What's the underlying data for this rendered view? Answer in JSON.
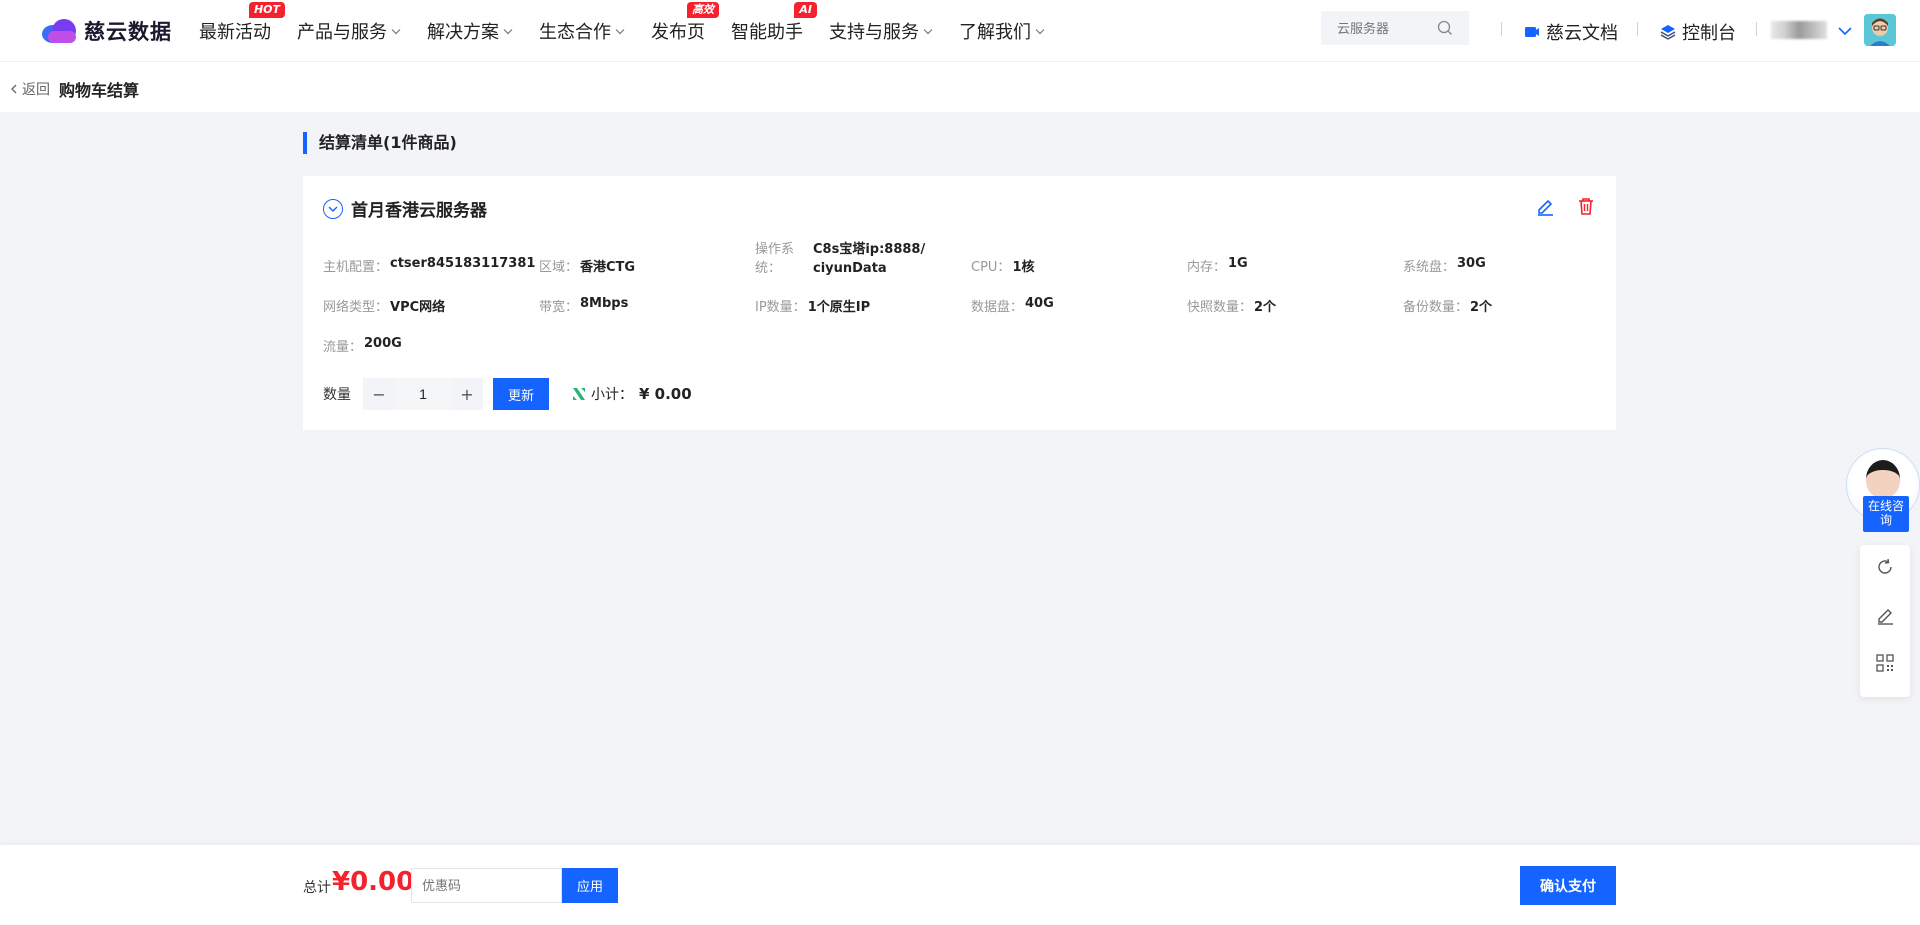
{
  "header": {
    "logo_text": "慈云数据",
    "nav": [
      {
        "label": "最新活动",
        "badge": "HOT",
        "has_dropdown": false
      },
      {
        "label": "产品与服务",
        "badge": "",
        "has_dropdown": true
      },
      {
        "label": "解决方案",
        "badge": "",
        "has_dropdown": true
      },
      {
        "label": "生态合作",
        "badge": "",
        "has_dropdown": true
      },
      {
        "label": "发布页",
        "badge": "高效",
        "has_dropdown": false
      },
      {
        "label": "智能助手",
        "badge": "AI",
        "has_dropdown": false
      },
      {
        "label": "支持与服务",
        "badge": "",
        "has_dropdown": true
      },
      {
        "label": "了解我们",
        "badge": "",
        "has_dropdown": true
      }
    ],
    "search_placeholder": "云服务器",
    "docs_label": "慈云文档",
    "console_label": "控制台"
  },
  "breadcrumb": {
    "back_label": "返回",
    "title": "购物车结算"
  },
  "section_title": "结算清单(1件商品)",
  "product": {
    "name": "首月香港云服务器",
    "specs": [
      {
        "label": "主机配置：",
        "value": "ctser845183117381"
      },
      {
        "label": "区域：",
        "value": "香港CTG"
      },
      {
        "label": "操作系统：",
        "value": "C8s宝塔ip:8888/ciyunData"
      },
      {
        "label": "CPU：",
        "value": "1核"
      },
      {
        "label": "内存：",
        "value": "1G"
      },
      {
        "label": "系统盘：",
        "value": "30G"
      },
      {
        "label": "网络类型：",
        "value": "VPC网络"
      },
      {
        "label": "带宽：",
        "value": "8Mbps"
      },
      {
        "label": "IP数量：",
        "value": "1个原生IP"
      },
      {
        "label": "数据盘：",
        "value": "40G"
      },
      {
        "label": "快照数量：",
        "value": "2个"
      },
      {
        "label": "备份数量：",
        "value": "2个"
      },
      {
        "label": "流量：",
        "value": "200G"
      }
    ],
    "quantity_label": "数量",
    "quantity": "1",
    "update_label": "更新",
    "subtotal_label": "小计：",
    "subtotal_value": "¥ 0.00"
  },
  "footer": {
    "total_label": "总计",
    "total_value": "¥0.00",
    "coupon_placeholder": "优惠码",
    "apply_label": "应用",
    "pay_label": "确认支付"
  },
  "side_widget": {
    "consult_label": "在线咨询"
  },
  "colors": {
    "primary": "#1664ff",
    "price_red": "#f5222d",
    "delete_red": "#f5222d",
    "page_bg": "#f3f4f7"
  }
}
